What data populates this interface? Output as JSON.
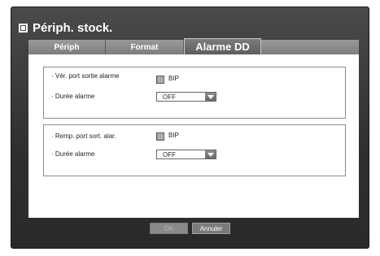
{
  "title": "Périph. stock.",
  "tabs": [
    {
      "label": "Périph"
    },
    {
      "label": "Format"
    },
    {
      "label": "Alarme DD"
    }
  ],
  "groups": [
    {
      "check_label": "· Vér. port sortie alarme",
      "check_text": "BIP",
      "duration_label": "· Durée alarme",
      "duration_value": "OFF"
    },
    {
      "check_label": "· Remp. port sort. alar.",
      "check_text": "BIP",
      "duration_label": "· Durée alarme",
      "duration_value": "OFF"
    }
  ],
  "buttons": {
    "ok": "OK",
    "cancel": "Annuler"
  }
}
